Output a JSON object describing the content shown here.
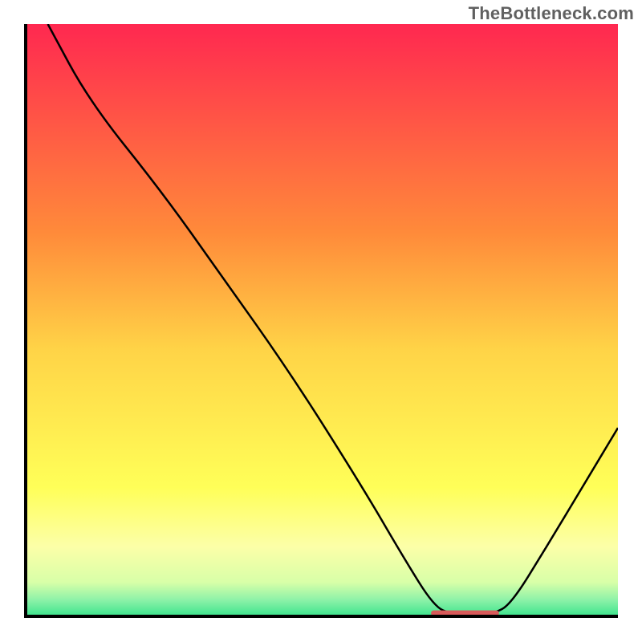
{
  "watermark": "TheBottleneck.com",
  "chart_data": {
    "type": "line",
    "title": "",
    "xlabel": "",
    "ylabel": "",
    "xlim": [
      0,
      100
    ],
    "ylim": [
      0,
      100
    ],
    "grid": false,
    "gradient_stops": [
      {
        "offset": 0.0,
        "color": "#ff2850"
      },
      {
        "offset": 0.35,
        "color": "#ff8a3a"
      },
      {
        "offset": 0.55,
        "color": "#ffd447"
      },
      {
        "offset": 0.78,
        "color": "#ffff58"
      },
      {
        "offset": 0.88,
        "color": "#fcffa8"
      },
      {
        "offset": 0.94,
        "color": "#d8ffa8"
      },
      {
        "offset": 0.97,
        "color": "#8cf2a8"
      },
      {
        "offset": 1.0,
        "color": "#33e28a"
      }
    ],
    "series": [
      {
        "name": "bottleneck-curve",
        "color": "#000000",
        "stroke_width": 2.5,
        "points": [
          {
            "x": 4.0,
            "y": 100.0
          },
          {
            "x": 11.0,
            "y": 87.0
          },
          {
            "x": 23.0,
            "y": 72.0
          },
          {
            "x": 33.0,
            "y": 58.0
          },
          {
            "x": 45.0,
            "y": 41.0
          },
          {
            "x": 57.0,
            "y": 22.0
          },
          {
            "x": 64.0,
            "y": 10.0
          },
          {
            "x": 69.0,
            "y": 2.0
          },
          {
            "x": 72.0,
            "y": 0.6
          },
          {
            "x": 76.0,
            "y": 0.5
          },
          {
            "x": 79.0,
            "y": 0.7
          },
          {
            "x": 82.0,
            "y": 2.3
          },
          {
            "x": 88.0,
            "y": 12.0
          },
          {
            "x": 94.0,
            "y": 22.0
          },
          {
            "x": 100.0,
            "y": 32.0
          }
        ]
      },
      {
        "name": "optimal-marker",
        "color": "#d85a5a",
        "stroke_width": 7,
        "points": [
          {
            "x": 69.0,
            "y": 0.8
          },
          {
            "x": 79.5,
            "y": 0.8
          }
        ]
      }
    ]
  }
}
